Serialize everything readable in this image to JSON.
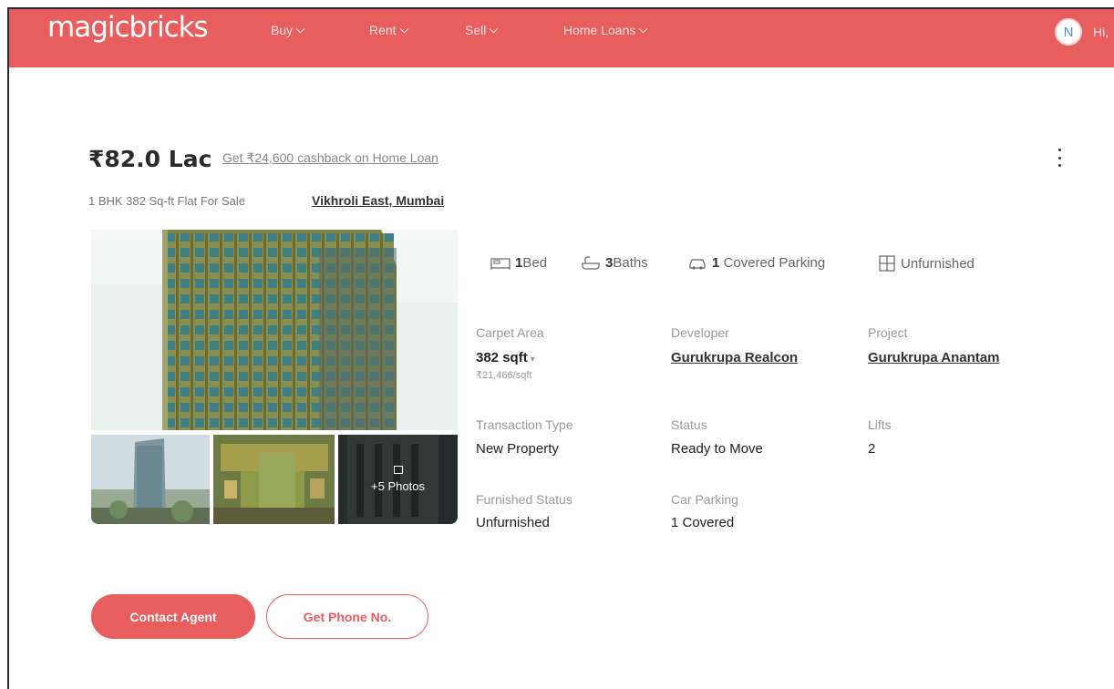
{
  "header": {
    "logo": "magicbricks",
    "nav": [
      {
        "label": "Buy"
      },
      {
        "label": "Rent"
      },
      {
        "label": "Sell"
      },
      {
        "label": "Home Loans"
      }
    ],
    "avatar_initial": "N",
    "greeting": "Hi,",
    "brand_color": "#e85d5d"
  },
  "listing": {
    "price": "₹82.0 Lac",
    "cashback_link": "Get ₹24,600 cashback on Home Loan",
    "subtitle": "1 BHK 382 Sq-ft Flat For Sale",
    "locality": "Vikhroli East, Mumbai"
  },
  "gallery": {
    "more_photos": "+5 Photos"
  },
  "amenities": [
    {
      "icon": "bed-icon",
      "value": "1",
      "label": "Bed"
    },
    {
      "icon": "bath-icon",
      "value": "3",
      "label": "Baths"
    },
    {
      "icon": "car-icon",
      "value": "1",
      "label": "Covered Parking"
    },
    {
      "icon": "furnish-icon",
      "value": "",
      "label": "Unfurnished"
    }
  ],
  "details": {
    "carpet_area": {
      "label": "Carpet Area",
      "value": "382 sqft",
      "sub": "₹21,466/sqft"
    },
    "developer": {
      "label": "Developer",
      "value": "Gurukrupa Realcon"
    },
    "project": {
      "label": "Project",
      "value": "Gurukrupa Anantam"
    },
    "transaction": {
      "label": "Transaction Type",
      "value": "New Property"
    },
    "status": {
      "label": "Status",
      "value": "Ready to Move"
    },
    "lifts": {
      "label": "Lifts",
      "value": "2"
    },
    "furnished": {
      "label": "Furnished Status",
      "value": "Unfurnished"
    },
    "car_parking": {
      "label": "Car Parking",
      "value": "1 Covered"
    }
  },
  "actions": {
    "contact": "Contact Agent",
    "phone": "Get Phone No."
  }
}
